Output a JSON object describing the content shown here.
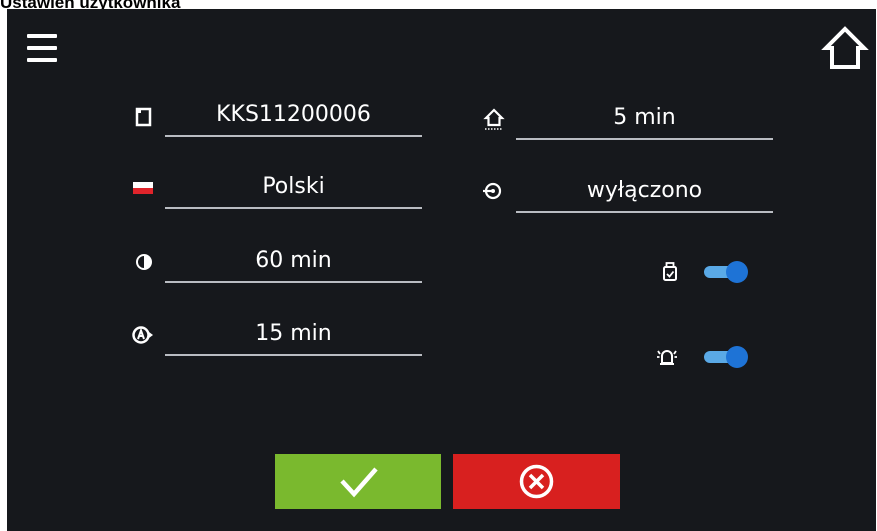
{
  "window": {
    "title": "Ustawień użytkownika"
  },
  "fields": {
    "device_id": "KKS11200006",
    "language": "Polski",
    "brightness_time": "60 min",
    "auto_logout": "15 min",
    "home_return": "5 min",
    "connection": "wyłączono"
  },
  "toggles": {
    "usb_enabled": true,
    "alarm_enabled": true
  },
  "icons": {
    "menu": "hamburger-menu-icon",
    "home": "home-icon",
    "device": "device-info-icon",
    "language": "polish-flag-icon",
    "brightness": "brightness-icon",
    "auto_logout": "auto-logout-icon",
    "home_timeout": "home-timeout-icon",
    "connection": "network-icon",
    "usb": "usb-stick-icon",
    "alarm": "alarm-bell-icon",
    "confirm": "check-icon",
    "cancel": "cancel-circle-icon"
  },
  "colors": {
    "background": "#16181c",
    "confirm": "#7ab92e",
    "cancel": "#d8201f",
    "toggle_on": "#1e73d6"
  }
}
